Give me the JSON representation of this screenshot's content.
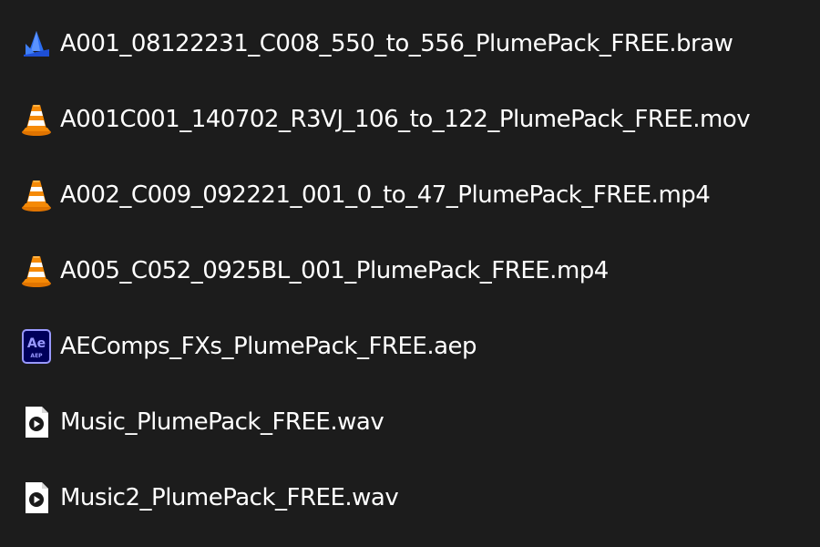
{
  "files": [
    {
      "name": "A001_08122231_C008_550_to_556_PlumePack_FREE.braw",
      "icon": "braw-file-icon"
    },
    {
      "name": "A001C001_140702_R3VJ_106_to_122_PlumePack_FREE.mov",
      "icon": "vlc-cone-icon"
    },
    {
      "name": "A002_C009_092221_001_0_to_47_PlumePack_FREE.mp4",
      "icon": "vlc-cone-icon"
    },
    {
      "name": "A005_C052_0925BL_001_PlumePack_FREE.mp4",
      "icon": "vlc-cone-icon"
    },
    {
      "name": "AEComps_FXs_PlumePack_FREE.aep",
      "icon": "after-effects-file-icon",
      "icon_text": {
        "main": "Ae",
        "sub": "AEP"
      }
    },
    {
      "name": "Music_PlumePack_FREE.wav",
      "icon": "audio-file-icon"
    },
    {
      "name": "Music2_PlumePack_FREE.wav",
      "icon": "audio-file-icon"
    }
  ],
  "colors": {
    "background": "#1c1c1c",
    "text": "#ffffff",
    "vlc_orange": "#f58a07",
    "ae_purple": "#9999ff",
    "ae_bg": "#00005b",
    "braw_blue": "#2a6df4"
  }
}
